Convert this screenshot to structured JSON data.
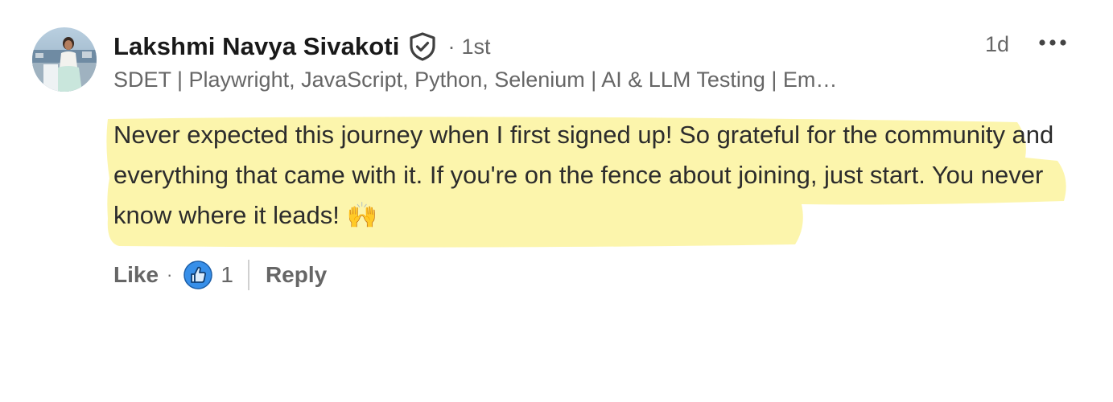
{
  "author": {
    "name": "Lakshmi Navya Sivakoti",
    "degree_separator": "·",
    "degree": "1st",
    "headline": "SDET | Playwright, JavaScript, Python, Selenium | AI & LLM Testing | Em…",
    "verified_icon": "shield-check-icon"
  },
  "meta": {
    "timestamp": "1d",
    "more_icon": "more-horizontal-icon"
  },
  "comment": {
    "text": "Never expected this journey when I first signed up! So grateful for the community and everything that came with it. If you're on the fence about joining, just start. You never know where it leads! 🙌",
    "highlight_color": "#fcf4a3"
  },
  "actions": {
    "like_label": "Like",
    "separator": "·",
    "reaction_icon": "like-thumb-icon",
    "reaction_count": "1",
    "reply_label": "Reply"
  },
  "colors": {
    "name": "#191919",
    "secondary": "#666666",
    "like_blue": "#378fe9"
  }
}
